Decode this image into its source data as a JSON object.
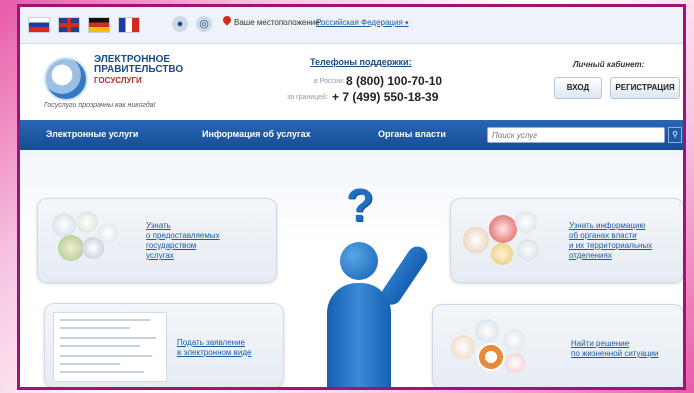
{
  "topbar": {
    "flags": [
      {
        "name": "russia-flag-icon"
      },
      {
        "name": "uk-flag-icon"
      },
      {
        "name": "germany-flag-icon"
      },
      {
        "name": "france-flag-icon"
      }
    ],
    "location_label": "Ваше местоположение:",
    "location_value": "Российская Федерация",
    "location_caret": "▾"
  },
  "header": {
    "brand_line1": "ЭЛЕКТРОННОЕ",
    "brand_line2": "ПРАВИТЕЛЬСТВО",
    "brand_line3": "ГОСУСЛУГИ",
    "tagline": "Госуслуги прозрачны как никогда!",
    "support_title": "Телефоны поддержки:",
    "support_russia_label": "в России:",
    "support_russia_phone": "8 (800) 100-70-10",
    "support_abroad_label": "за границей:",
    "support_abroad_phone": "+ 7 (499) 550-18-39",
    "cabinet_title": "Личный кабинет:",
    "login_button": "ВХОД",
    "register_button": "РЕГИСТРАЦИЯ"
  },
  "nav": {
    "items": [
      {
        "label": "Электронные услуги"
      },
      {
        "label": "Информация об услугах"
      },
      {
        "label": "Органы власти"
      }
    ],
    "search_placeholder": "Поиск услуг"
  },
  "main": {
    "question_mark": "?",
    "panel1": {
      "line1": "Узнать",
      "line2": "о предоставляемых",
      "line3": "государством",
      "line4": "услугах"
    },
    "panel2": {
      "line1": "Узнать информацию",
      "line2": "об органах власти",
      "line3": "и их территориальных",
      "line4": "отделениях"
    },
    "panel3": {
      "line1": "Подать заявление",
      "line2": "в электронном виде"
    },
    "panel4": {
      "line1": "Найти решение",
      "line2": "по жизненной ситуации"
    }
  },
  "colors": {
    "accent": "#1c5aa5",
    "nav": "#1f5aa6",
    "frame": "#a01273"
  }
}
